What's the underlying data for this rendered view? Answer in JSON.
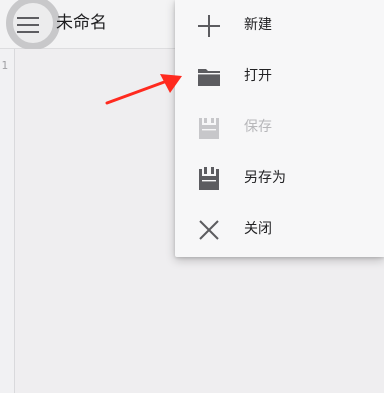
{
  "toolbar": {
    "title": "未命名",
    "menu_icon": "hamburger-menu-icon"
  },
  "gutter": {
    "line_number": "1"
  },
  "dropdown_menu": {
    "items": [
      {
        "label": "新建",
        "icon": "plus-icon",
        "enabled": true
      },
      {
        "label": "打开",
        "icon": "folder-icon",
        "enabled": true
      },
      {
        "label": "保存",
        "icon": "save-icon",
        "enabled": false
      },
      {
        "label": "另存为",
        "icon": "save-as-icon",
        "enabled": true
      },
      {
        "label": "关闭",
        "icon": "close-icon",
        "enabled": true
      }
    ]
  },
  "annotation": {
    "arrow_icon": "red-arrow-icon",
    "arrow_color": "#ff2a1f",
    "points_to": "打开"
  },
  "colors": {
    "background": "#efeef0",
    "menu_background": "#f7f7f8",
    "icon_color": "#5c5c60",
    "disabled_color": "#c7c7ca"
  }
}
